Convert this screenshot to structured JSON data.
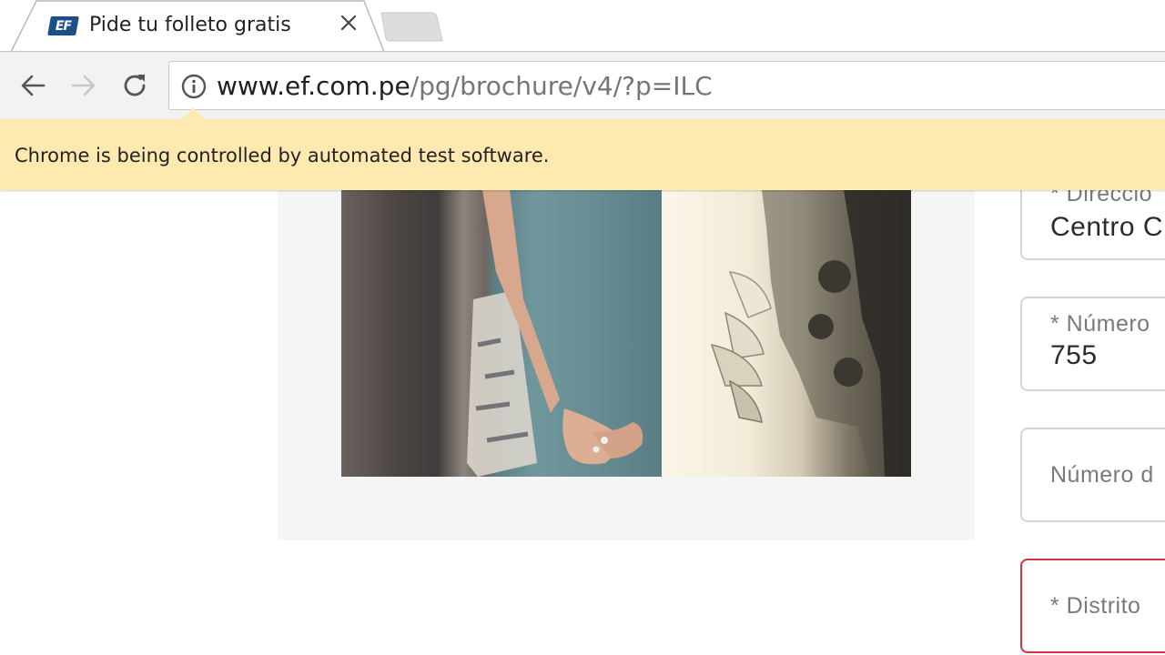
{
  "tab": {
    "favicon_text": "EF",
    "title": "Pide tu folleto gratis",
    "close_glyph": "×"
  },
  "toolbar": {
    "url_host": "www.ef.com.pe",
    "url_path": "/pg/brochure/v4/?p=ILC"
  },
  "infobar": {
    "message": "Chrome is being controlled by automated test software."
  },
  "form": {
    "fields": [
      {
        "label": "* Direccio",
        "value": "Centro C",
        "state": "filled"
      },
      {
        "label": "* Número",
        "value": "755",
        "state": "filled"
      },
      {
        "label": "Número d",
        "value": "",
        "state": "empty"
      },
      {
        "label": "* Distrito",
        "value": "",
        "state": "error"
      }
    ]
  },
  "colors": {
    "infobar_bg": "#feeab0",
    "error_border": "#d6323b",
    "favicon_bg": "#1b4f88"
  }
}
